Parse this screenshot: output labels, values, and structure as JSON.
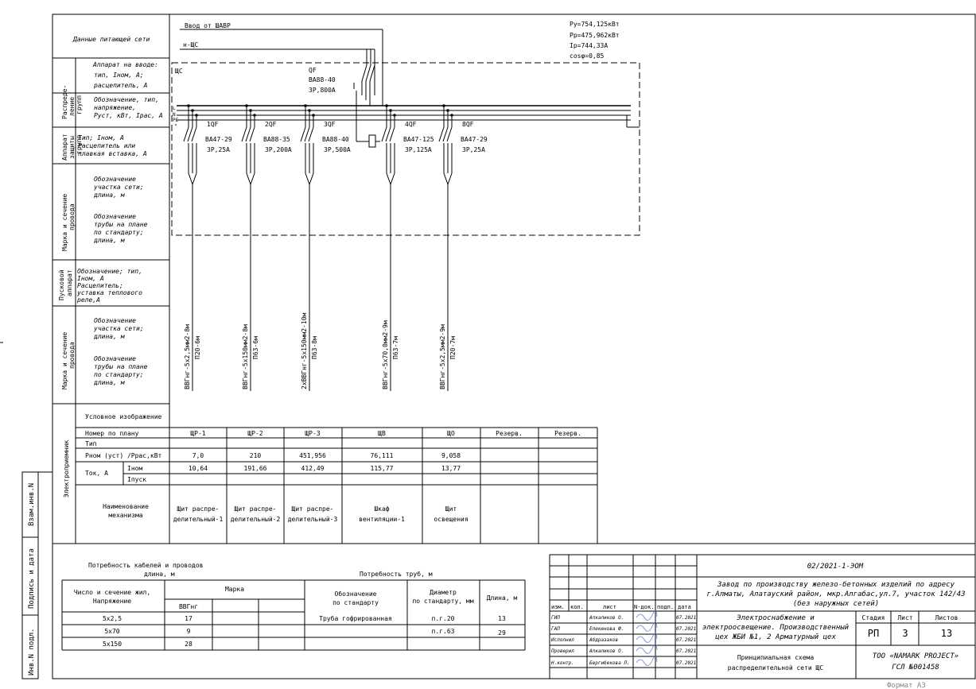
{
  "supply": {
    "input_label": "Ввод от ШАВР",
    "cable_label": "н-ЩС",
    "panel_label": "ЩС",
    "pe_labels": [
      "L",
      "N",
      "PE"
    ],
    "params": [
      "Py=754,125кВт",
      "Pp=475,962кВт",
      "Ip=744,33А",
      "cosφ=0,85"
    ]
  },
  "main_breaker": {
    "name": "QF",
    "type": "ВА88-40",
    "rating": "3Р,800А"
  },
  "feeders": [
    {
      "name": "1QF",
      "type": "ВА47-29",
      "rating": "3Р,25А",
      "cable": "ВВГнг-5х2,5мм2-8м",
      "pipe": "П20-6м",
      "panel": "ЩР-1",
      "p": "7,0",
      "inom": "10,64",
      "desc1": "Щит распре-",
      "desc2": "делительный-1"
    },
    {
      "name": "2QF",
      "type": "ВА88-35",
      "rating": "3Р,200А",
      "cable": "ВВГнг-5х150мм2-8м",
      "pipe": "П63-6м",
      "panel": "ЩР-2",
      "p": "210",
      "inom": "191,66",
      "desc1": "Щит распре-",
      "desc2": "делительный-2"
    },
    {
      "name": "3QF",
      "type": "ВА88-40",
      "rating": "3Р,500А",
      "cable": "2хВВГнг-5х150мм2-10м",
      "pipe": "П63-8м",
      "panel": "ЩР-3",
      "p": "451,956",
      "inom": "412,49",
      "desc1": "Щит распре-",
      "desc2": "делительный-3"
    },
    {
      "name": "4QF",
      "type": "ВА47-125",
      "rating": "3Р,125А",
      "cable": "ВВГнг-5х70,0мм2-9м",
      "pipe": "П63-7м",
      "panel": "ЩВ",
      "p": "76,111",
      "inom": "115,77",
      "desc1": "Шкаф",
      "desc2": "вентиляции-1"
    },
    {
      "name": "8QF",
      "type": "ВА47-29",
      "rating": "3Р,25А",
      "cable": "ВВГнг-5х2,5мм2-9м",
      "pipe": "П20-7м",
      "panel": "ЩО",
      "p": "9,058",
      "inom": "13,77",
      "desc1": "Щит",
      "desc2": "освещения"
    }
  ],
  "reserve": [
    "Резерв.",
    "Резерв."
  ],
  "left_headers": {
    "supply_data": "Данные питающей сети",
    "apparatus": [
      "Аппарат на вводе:",
      "тип, Iном, А;",
      "расцепитель, А"
    ],
    "designation": [
      "Обозначение, тип,",
      "напряжение,",
      "Руст, кВт, Iрас, А"
    ],
    "feeder_type": [
      "Тип; Iном, А",
      "Расцепитель или",
      "плавкая вставка, А"
    ],
    "section1": [
      "Обозначение",
      "участка сети;",
      "длина, м"
    ],
    "pipe1": [
      "Обозначение",
      "трубы на плане",
      "по стандарту;",
      "длина, м"
    ],
    "breaker2": [
      "Обозначение; тип,",
      "Iном, А",
      "Расцепитель;",
      "уставка теплового",
      "реле,А"
    ],
    "section2": [
      "Обозначение",
      "участка сети;",
      "длина, м"
    ],
    "pipe2": [
      "Обозначение",
      "трубы на плане",
      "по стандарту;",
      "длина, м"
    ],
    "symbol": "Условное изображение",
    "plan_number": "Номер по плану",
    "type_row": "Тип",
    "power_row": "Рном (уст) /Ррас,кВт",
    "current_row": "Ток, А",
    "inom": "Iном",
    "ipusk": "Iпуск",
    "mechanism": [
      "Наименование",
      "механизма"
    ]
  },
  "vertical_labels": [
    "Распреде-",
    "ление",
    "групп",
    "Аппарат",
    "защиты",
    "групп",
    "Марка и сечение",
    "провода",
    "Пусковой",
    "аппарат",
    "Марка и сечение",
    "провода",
    "Электроприемник"
  ],
  "stamp_side": [
    "Взам.инв.N",
    "Подпись и дата",
    "Инв.N подл."
  ],
  "cable_needs": {
    "title1": "Потребность кабелей и проводов",
    "title2": "длина, м",
    "col1": [
      "Число и сечение жил,",
      "Напряжение"
    ],
    "col_mark": "Марка",
    "col_mark_sub": "ВВГнг",
    "rows": [
      [
        "5х2,5",
        "17"
      ],
      [
        "5х70",
        "9"
      ],
      [
        "5х150",
        "28"
      ]
    ]
  },
  "pipe_needs": {
    "title": "Потребность труб, м",
    "col1": [
      "Обозначение",
      "по стандарту"
    ],
    "col2": [
      "Диаметр",
      "по стандарту, мм"
    ],
    "col3": "Длина, м",
    "rows": [
      [
        "Труба гофрированная",
        "п.г.20",
        "13"
      ],
      [
        "",
        "п.г.63",
        "29"
      ]
    ]
  },
  "title_block": {
    "code": "02/2021-1-ЭОМ",
    "object": [
      "Завод по производству железо-бетонных изделий по адресу",
      "г.Алматы, Алатауский район, мкр.Алгабас,ул.7, участок 142/43",
      "(без наружных сетей)"
    ],
    "col_heads": [
      "изм.",
      "кол.",
      "лист",
      "N-док.",
      "подп.",
      "дата"
    ],
    "staff": [
      [
        "ГИП",
        "Алкаликов О.",
        "07.2021"
      ],
      [
        "ГАП",
        "Елекенова Ф.",
        "07.2021"
      ],
      [
        "Исполнил",
        "Абдразаков",
        "07.2021"
      ],
      [
        "Проверил",
        "Алкаликов О.",
        "07.2021"
      ],
      [
        "Н.контр.",
        "Бергибекова Л.",
        "07.2021"
      ]
    ],
    "section": [
      "Электроснабжение и",
      "электроосвещение. Производственный",
      "цех ЖБИ №1, 2 Арматурный цех"
    ],
    "stage_head": "Стадия",
    "sheet_head": "Лист",
    "sheets_head": "Листов",
    "stage": "РП",
    "sheet": "3",
    "sheets": "13",
    "drawing": [
      "Принципиальная схема",
      "распределительной сети ЩС"
    ],
    "company": [
      "ТОО «NAMARK PROJECT»",
      "ГСЛ №001458"
    ]
  },
  "format": "Формат А3"
}
